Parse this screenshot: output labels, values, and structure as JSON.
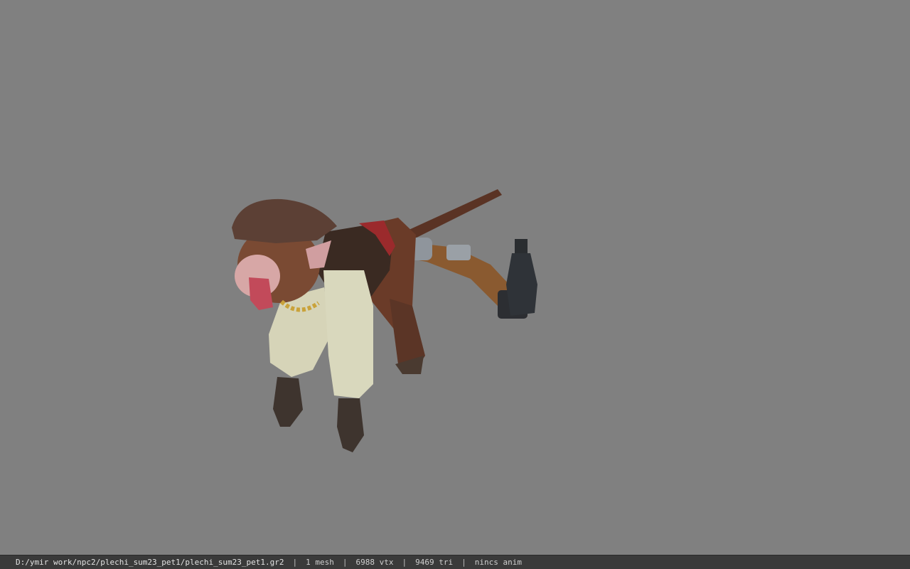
{
  "viewer": {
    "background_color": "#808080",
    "model_description_icon": "monkey-pirate-model"
  },
  "statusbar": {
    "file_path": "D:/ymir work/npc2/plechi_sum23_pet1/plechi_sum23_pet1.gr2",
    "separator": "|",
    "mesh_count": "1 mesh",
    "vertex_count": "6988 vtx",
    "triangle_count": "9469 tri",
    "animation": "nincs anim"
  }
}
